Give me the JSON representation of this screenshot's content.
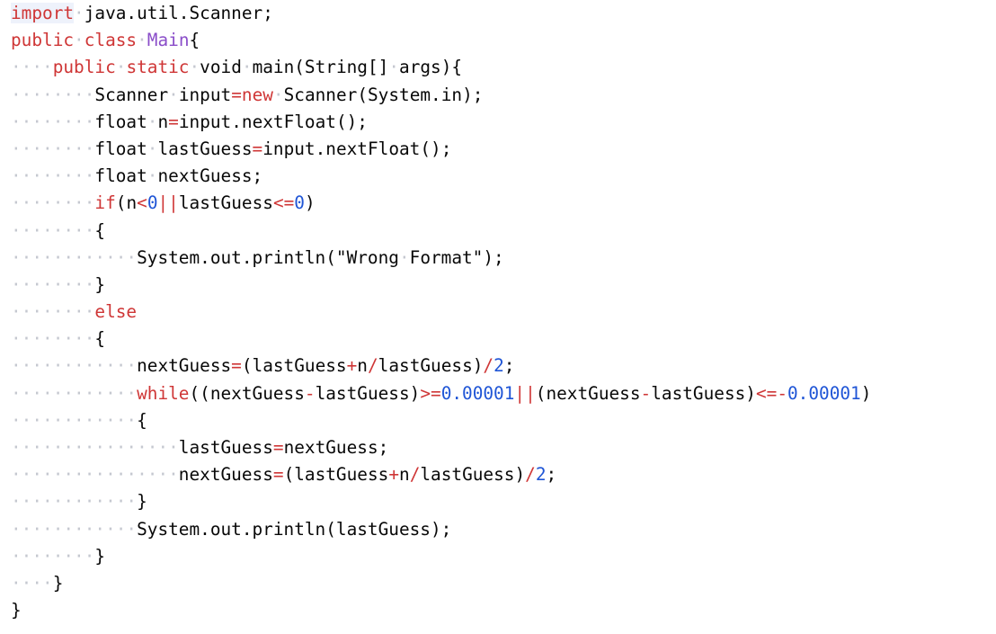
{
  "editor": {
    "language": "java",
    "colors": {
      "keyword": "#cf3636",
      "class_name": "#8a4dc9",
      "number": "#1f55d6",
      "operator": "#cf3636",
      "whitespace_marker": "#c5c8d0",
      "text": "#080808"
    },
    "lines": [
      {
        "indent": 0,
        "tokens": [
          {
            "t": "kw",
            "v": "import"
          },
          {
            "t": "ws",
            "v": "·"
          },
          {
            "t": "tx",
            "v": "java.util.Scanner;"
          }
        ]
      },
      {
        "indent": 0,
        "tokens": [
          {
            "t": "kw",
            "v": "public"
          },
          {
            "t": "ws",
            "v": "·"
          },
          {
            "t": "kw",
            "v": "class"
          },
          {
            "t": "ws",
            "v": "·"
          },
          {
            "t": "cls",
            "v": "Main"
          },
          {
            "t": "tx",
            "v": "{"
          }
        ]
      },
      {
        "indent": 4,
        "tokens": [
          {
            "t": "kw",
            "v": "public"
          },
          {
            "t": "ws",
            "v": "·"
          },
          {
            "t": "kw",
            "v": "static"
          },
          {
            "t": "ws",
            "v": "·"
          },
          {
            "t": "tx",
            "v": "void"
          },
          {
            "t": "ws",
            "v": "·"
          },
          {
            "t": "tx",
            "v": "main(String[]"
          },
          {
            "t": "ws",
            "v": "·"
          },
          {
            "t": "tx",
            "v": "args){"
          }
        ]
      },
      {
        "indent": 8,
        "tokens": [
          {
            "t": "tx",
            "v": "Scanner"
          },
          {
            "t": "ws",
            "v": "·"
          },
          {
            "t": "tx",
            "v": "input"
          },
          {
            "t": "op",
            "v": "="
          },
          {
            "t": "kw",
            "v": "new"
          },
          {
            "t": "ws",
            "v": "·"
          },
          {
            "t": "tx",
            "v": "Scanner(System.in);"
          }
        ]
      },
      {
        "indent": 8,
        "tokens": [
          {
            "t": "tx",
            "v": "float"
          },
          {
            "t": "ws",
            "v": "·"
          },
          {
            "t": "tx",
            "v": "n"
          },
          {
            "t": "op",
            "v": "="
          },
          {
            "t": "tx",
            "v": "input.nextFloat();"
          }
        ]
      },
      {
        "indent": 8,
        "tokens": [
          {
            "t": "tx",
            "v": "float"
          },
          {
            "t": "ws",
            "v": "·"
          },
          {
            "t": "tx",
            "v": "lastGuess"
          },
          {
            "t": "op",
            "v": "="
          },
          {
            "t": "tx",
            "v": "input.nextFloat();"
          }
        ]
      },
      {
        "indent": 8,
        "tokens": [
          {
            "t": "tx",
            "v": "float"
          },
          {
            "t": "ws",
            "v": "·"
          },
          {
            "t": "tx",
            "v": "nextGuess;"
          }
        ]
      },
      {
        "indent": 8,
        "tokens": [
          {
            "t": "kw",
            "v": "if"
          },
          {
            "t": "tx",
            "v": "(n"
          },
          {
            "t": "op",
            "v": "<"
          },
          {
            "t": "num",
            "v": "0"
          },
          {
            "t": "op",
            "v": "||"
          },
          {
            "t": "tx",
            "v": "lastGuess"
          },
          {
            "t": "op",
            "v": "<="
          },
          {
            "t": "num",
            "v": "0"
          },
          {
            "t": "tx",
            "v": ")"
          }
        ]
      },
      {
        "indent": 8,
        "tokens": [
          {
            "t": "tx",
            "v": "{"
          }
        ]
      },
      {
        "indent": 12,
        "tokens": [
          {
            "t": "tx",
            "v": "System.out.println(\"Wrong"
          },
          {
            "t": "ws",
            "v": "·"
          },
          {
            "t": "tx",
            "v": "Format\");"
          }
        ]
      },
      {
        "indent": 8,
        "tokens": [
          {
            "t": "tx",
            "v": "}"
          }
        ]
      },
      {
        "indent": 8,
        "tokens": [
          {
            "t": "kw",
            "v": "else"
          }
        ]
      },
      {
        "indent": 8,
        "tokens": [
          {
            "t": "tx",
            "v": "{"
          }
        ]
      },
      {
        "indent": 12,
        "tokens": [
          {
            "t": "tx",
            "v": "nextGuess"
          },
          {
            "t": "op",
            "v": "="
          },
          {
            "t": "tx",
            "v": "(lastGuess"
          },
          {
            "t": "op",
            "v": "+"
          },
          {
            "t": "tx",
            "v": "n"
          },
          {
            "t": "op",
            "v": "/"
          },
          {
            "t": "tx",
            "v": "lastGuess)"
          },
          {
            "t": "op",
            "v": "/"
          },
          {
            "t": "num",
            "v": "2"
          },
          {
            "t": "tx",
            "v": ";"
          }
        ]
      },
      {
        "indent": 12,
        "tokens": [
          {
            "t": "kw",
            "v": "while"
          },
          {
            "t": "tx",
            "v": "((nextGuess"
          },
          {
            "t": "op",
            "v": "-"
          },
          {
            "t": "tx",
            "v": "lastGuess)"
          },
          {
            "t": "op",
            "v": ">="
          },
          {
            "t": "num",
            "v": "0.00001"
          },
          {
            "t": "op",
            "v": "||"
          },
          {
            "t": "tx",
            "v": "(nextGuess"
          },
          {
            "t": "op",
            "v": "-"
          },
          {
            "t": "tx",
            "v": "lastGuess)"
          },
          {
            "t": "op",
            "v": "<=-"
          },
          {
            "t": "num",
            "v": "0.00001"
          },
          {
            "t": "tx",
            "v": ")"
          }
        ]
      },
      {
        "indent": 12,
        "tokens": [
          {
            "t": "tx",
            "v": "{"
          }
        ]
      },
      {
        "indent": 16,
        "tokens": [
          {
            "t": "tx",
            "v": "lastGuess"
          },
          {
            "t": "op",
            "v": "="
          },
          {
            "t": "tx",
            "v": "nextGuess;"
          }
        ]
      },
      {
        "indent": 16,
        "tokens": [
          {
            "t": "tx",
            "v": "nextGuess"
          },
          {
            "t": "op",
            "v": "="
          },
          {
            "t": "tx",
            "v": "(lastGuess"
          },
          {
            "t": "op",
            "v": "+"
          },
          {
            "t": "tx",
            "v": "n"
          },
          {
            "t": "op",
            "v": "/"
          },
          {
            "t": "tx",
            "v": "lastGuess)"
          },
          {
            "t": "op",
            "v": "/"
          },
          {
            "t": "num",
            "v": "2"
          },
          {
            "t": "tx",
            "v": ";"
          }
        ]
      },
      {
        "indent": 12,
        "tokens": [
          {
            "t": "tx",
            "v": "}"
          }
        ]
      },
      {
        "indent": 12,
        "tokens": [
          {
            "t": "tx",
            "v": "System.out.println(lastGuess);"
          }
        ]
      },
      {
        "indent": 8,
        "tokens": [
          {
            "t": "tx",
            "v": "}"
          }
        ]
      },
      {
        "indent": 4,
        "tokens": [
          {
            "t": "tx",
            "v": "}"
          }
        ]
      },
      {
        "indent": 0,
        "tokens": [
          {
            "t": "tx",
            "v": "}"
          }
        ]
      }
    ]
  }
}
